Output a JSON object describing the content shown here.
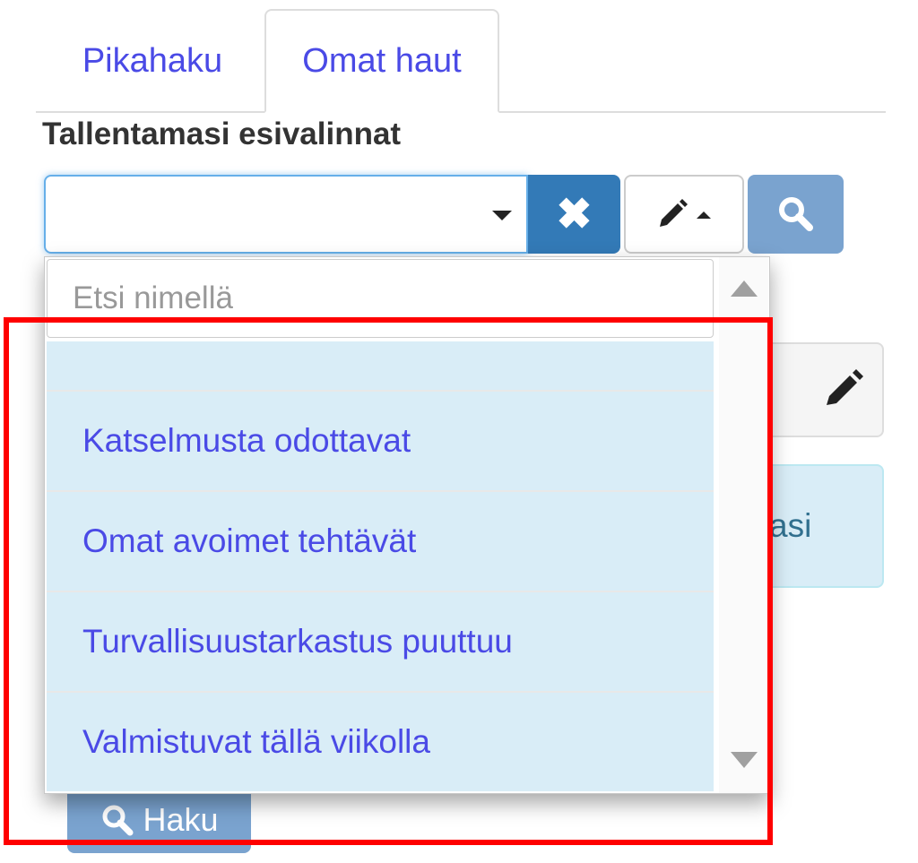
{
  "tabs": [
    {
      "label": "Pikahaku",
      "active": false
    },
    {
      "label": "Omat haut",
      "active": true
    }
  ],
  "section_label": "Tallentamasi esivalinnat",
  "select": {
    "value": ""
  },
  "dropdown": {
    "search_placeholder": "Etsi nimellä",
    "items": [
      {
        "label": ""
      },
      {
        "label": "Katselmusta odottavat"
      },
      {
        "label": "Omat avoimet tehtävät"
      },
      {
        "label": "Turvallisuustarkastus puuttuu"
      },
      {
        "label": "Valmistuvat tällä viikolla"
      }
    ]
  },
  "background": {
    "info_text_fragment": "asi",
    "haku_button_label": "Haku"
  },
  "icons": {
    "clear": "close-icon",
    "edit": "pencil-icon",
    "search": "search-icon"
  },
  "colors": {
    "link": "#4a4ae6",
    "primary": "#337ab7",
    "primary_disabled": "#7aa3cf",
    "dropdown_bg": "#d9edf7",
    "highlight": "#ff0000"
  }
}
